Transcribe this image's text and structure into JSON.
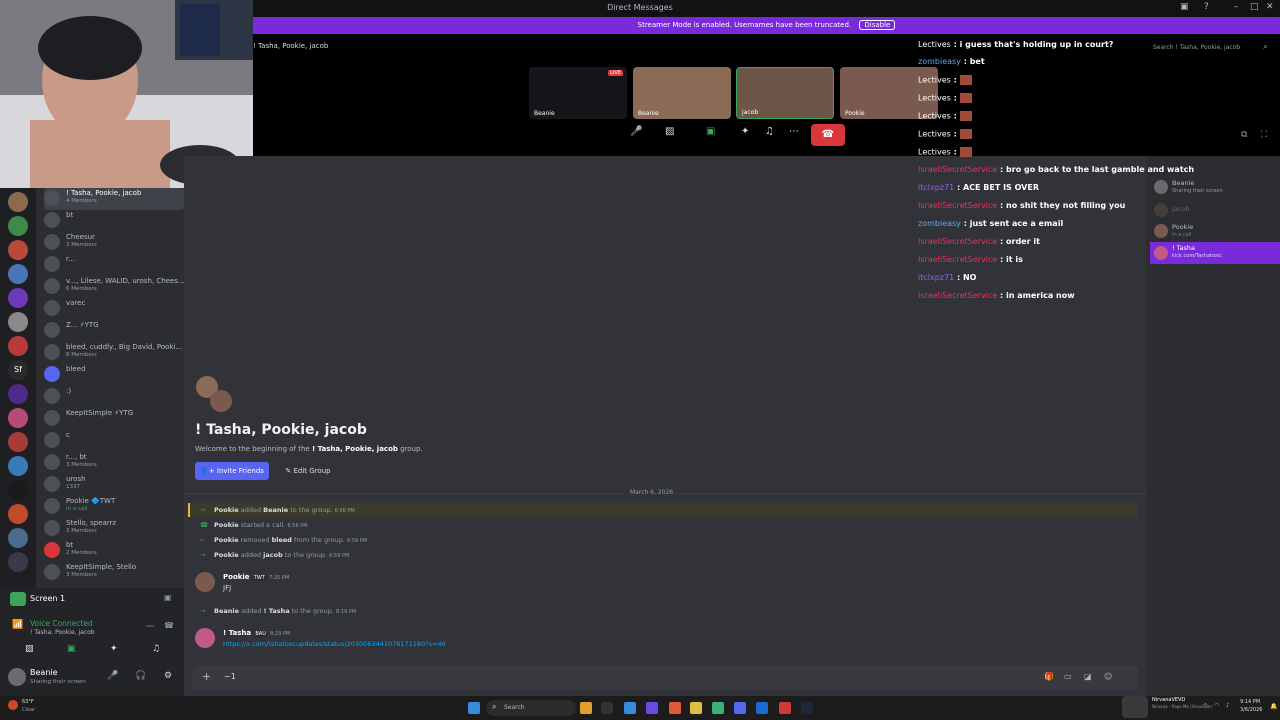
{
  "window": {
    "title": "Direct Messages"
  },
  "streamer_banner": {
    "text": "Streamer Mode is enabled. Usernames have been truncated.",
    "disable_label": "Disable"
  },
  "call": {
    "group_name": "! Tasha, Pookie, jacob",
    "tiles": [
      {
        "name": "Beanie",
        "live": "LIVE"
      },
      {
        "name": "Beanie"
      },
      {
        "name": "jacob"
      },
      {
        "name": "Pookie"
      }
    ]
  },
  "search": {
    "placeholder": "Search ! Tasha, Pookie, jacob"
  },
  "chat_overlay": [
    {
      "user": "Lectives",
      "sep": " : ",
      "text": "i guess that's holding up in court?",
      "color": "#ffffff"
    },
    {
      "user": "zombieasy",
      "sep": " : ",
      "text": "bet",
      "color": "#5ea5f2"
    },
    {
      "user": "Lectives",
      "sep": " : ",
      "text": "",
      "color": "#ffffff"
    },
    {
      "user": "Lectives",
      "sep": " : ",
      "text": "",
      "color": "#ffffff"
    },
    {
      "user": "Lectives",
      "sep": " : ",
      "text": "",
      "color": "#ffffff"
    },
    {
      "user": "Lectives",
      "sep": " : ",
      "text": "",
      "color": "#ffffff"
    },
    {
      "user": "Lectives",
      "sep": " : ",
      "text": "",
      "color": "#ffffff"
    },
    {
      "user": "IsraeliSecretService",
      "sep": " : ",
      "text": "bro go back to the last gamble and watch",
      "color": "#e8335a"
    },
    {
      "user": "itclxpz71",
      "sep": " : ",
      "text": "ACE BET IS OVER",
      "color": "#9b5ef2"
    },
    {
      "user": "IsraeliSecretService",
      "sep": " : ",
      "text": "no shit they not filling you",
      "color": "#e8335a"
    },
    {
      "user": "zombieasy",
      "sep": " : ",
      "text": "just sent ace a email",
      "color": "#5ea5f2"
    },
    {
      "user": "IsraeliSecretService",
      "sep": " : ",
      "text": "order it",
      "color": "#e8335a"
    },
    {
      "user": "IsraeliSecretService",
      "sep": " : ",
      "text": "it is",
      "color": "#e8335a"
    },
    {
      "user": "itclxpz71",
      "sep": " : ",
      "text": "NO",
      "color": "#9b5ef2"
    },
    {
      "user": "IsraeliSecretService",
      "sep": " : ",
      "text": "in america now",
      "color": "#e8335a"
    }
  ],
  "dm_list": [
    {
      "name": "! Tasha, Pookie, jacob",
      "sub": "4 Members"
    },
    {
      "name": "bt",
      "sub": ""
    },
    {
      "name": "Cheesur",
      "sub": "3 Members"
    },
    {
      "name": "r...",
      "sub": ""
    },
    {
      "name": "v..., Lilese, WALID, urosh, Chees...",
      "sub": "6 Members"
    },
    {
      "name": "varec",
      "sub": ""
    },
    {
      "name": "Z... ⚡YTG",
      "sub": ""
    },
    {
      "name": "bleed, cuddly., Big David, Pooki...",
      "sub": "8 Members"
    },
    {
      "name": "bleed",
      "sub": ""
    },
    {
      "name": ":)",
      "sub": ""
    },
    {
      "name": "KeepItSimple ⚡YTG",
      "sub": ""
    },
    {
      "name": "c",
      "sub": ""
    },
    {
      "name": "r..., bt",
      "sub": "3 Members"
    },
    {
      "name": "urosh",
      "sub": "1337"
    },
    {
      "name": "Pookie 🔷TWT",
      "sub": "In a call"
    },
    {
      "name": "Stello, spearrz",
      "sub": "3 Members"
    },
    {
      "name": "bt",
      "sub": "2 Members"
    },
    {
      "name": "KeepItSimple, Stello",
      "sub": "3 Members"
    }
  ],
  "voice": {
    "screen_label": "Screen 1",
    "status": "Voice Connected",
    "channel": "! Tasha, Pookie, jacob"
  },
  "user": {
    "name": "Beanie",
    "status": "Sharing their screen"
  },
  "main": {
    "heading": "! Tasha, Pookie, jacob",
    "welcome_prefix": "Welcome to the beginning of the ",
    "welcome_group": "! Tasha, Pookie, jacob",
    "welcome_suffix": " group.",
    "invite_label": "Invite Friends",
    "edit_label": "Edit Group",
    "date_divider": "March 6, 2026",
    "system_msgs": [
      {
        "actor": "Pookie",
        "action": " added ",
        "target": "Beanie",
        "tail": " to the group.",
        "time": "6:56 PM",
        "kind": "add"
      },
      {
        "actor": "Pookie",
        "action": " started a call.",
        "target": "",
        "tail": "",
        "time": "6:56 PM",
        "kind": "call"
      },
      {
        "actor": "Pookie",
        "action": " removed ",
        "target": "bleed",
        "tail": " from the group.",
        "time": "6:59 PM",
        "kind": "remove"
      },
      {
        "actor": "Pookie",
        "action": " added ",
        "target": "jacob",
        "tail": " to the group.",
        "time": "6:59 PM",
        "kind": "add"
      }
    ],
    "msg1": {
      "author": "Pookie",
      "tag": "TWT",
      "time": "7:20 PM",
      "text": "JFJ"
    },
    "sys5": {
      "actor": "Beanie",
      "action": " added ",
      "target": "! Tasha",
      "tail": " to the group.",
      "time": "8:19 PM"
    },
    "msg2": {
      "author": "! Tasha",
      "tag": "BAU",
      "time": "8:23 PM",
      "text": "https://x.com/tshatoxcupdates/status/2030063441076171180?s=46"
    },
    "composer_text": "~1"
  },
  "members": [
    {
      "name": "Beanie",
      "sub": "Sharing their screen"
    },
    {
      "name": "jacob",
      "sub": ""
    },
    {
      "name": "Pookie",
      "sub": "In a call"
    },
    {
      "name": "! Tasha",
      "sub": "kick.com/Tashatoxic"
    }
  ],
  "taskbar": {
    "weather_temp": "63°F",
    "weather_desc": "Clear",
    "search_label": "Search",
    "now_playing_title": "NirvanaVEVO",
    "now_playing_sub": "Nirvana - Rape Me (Visualizer)",
    "time": "9:14 PM",
    "date": "3/6/2026"
  }
}
